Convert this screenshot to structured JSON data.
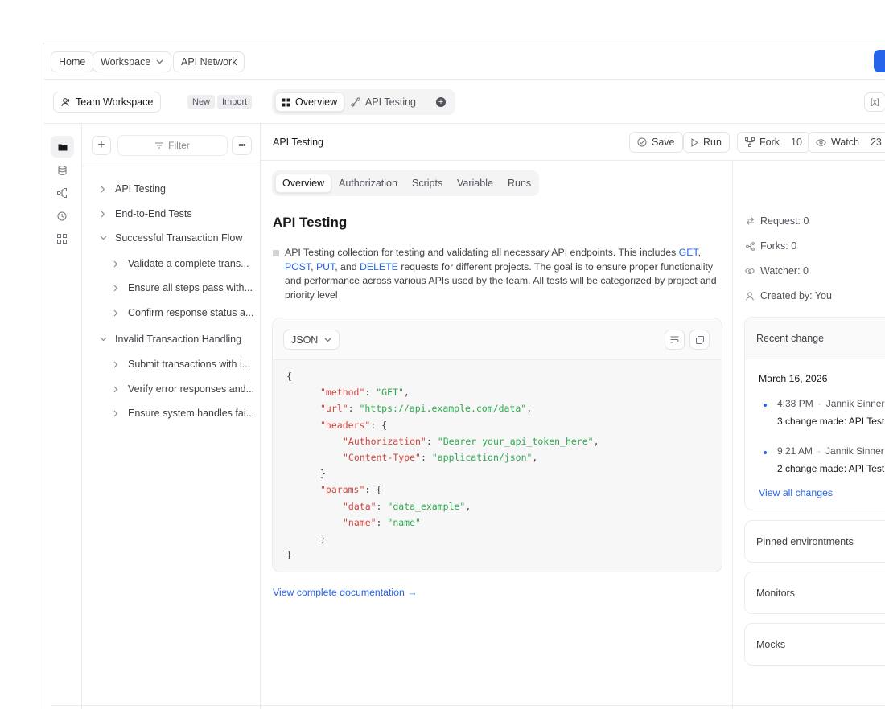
{
  "topnav": {
    "home": "Home",
    "workspace": "Workspace",
    "api_network": "API Network"
  },
  "workspace_bar": {
    "team_workspace": "Team Workspace",
    "new": "New",
    "import": "Import"
  },
  "main_tabs": [
    {
      "label": "Overview",
      "active": true
    },
    {
      "label": "API Testing",
      "active": false
    }
  ],
  "env_chip": "[x]",
  "sidebar": {
    "filter_placeholder": "Filter",
    "items": [
      {
        "label": "API Testing",
        "level": 0,
        "expanded": false
      },
      {
        "label": "End-to-End Tests",
        "level": 0,
        "expanded": false
      },
      {
        "label": "Successful Transaction Flow",
        "level": 0,
        "expanded": true
      },
      {
        "label": "Validate a complete trans...",
        "level": 1,
        "expanded": false
      },
      {
        "label": "Ensure all steps pass with...",
        "level": 1,
        "expanded": false
      },
      {
        "label": "Confirm response status a...",
        "level": 1,
        "expanded": false
      },
      {
        "label": "Invalid Transaction Handling",
        "level": 0,
        "expanded": true
      },
      {
        "label": "Submit transactions with i...",
        "level": 1,
        "expanded": false
      },
      {
        "label": "Verify error responses and...",
        "level": 1,
        "expanded": false
      },
      {
        "label": "Ensure system handles fai...",
        "level": 1,
        "expanded": false
      }
    ]
  },
  "header": {
    "title": "API Testing",
    "save": "Save",
    "run": "Run",
    "fork": "Fork",
    "fork_count": "10",
    "watch": "Watch",
    "watch_count": "23"
  },
  "subtabs": [
    {
      "label": "Overview",
      "active": true
    },
    {
      "label": "Authorization",
      "active": false
    },
    {
      "label": "Scripts",
      "active": false
    },
    {
      "label": "Variable",
      "active": false
    },
    {
      "label": "Runs",
      "active": false
    }
  ],
  "overview": {
    "heading": "API Testing",
    "desc_a": "API Testing collection for testing and validating all necessary API endpoints. This includes ",
    "get": "GET",
    "comma1": ",",
    "post": "POST",
    "comma2": ", ",
    "put": "PUT",
    "and": ", and ",
    "delete": "DELETE",
    "desc_b": " requests for different projects. The goal is to ensure proper functionality",
    "line3": "and performance across various APIs used by the team. All tests will be categorized by project and",
    "line4": "priority level"
  },
  "code": {
    "format": "JSON",
    "lines": [
      {
        "indent": 0,
        "parts": [
          {
            "t": "p",
            "v": "{"
          }
        ]
      },
      {
        "indent": 1,
        "parts": [
          {
            "t": "k",
            "v": "\"method\""
          },
          {
            "t": "p",
            "v": ": "
          },
          {
            "t": "s",
            "v": "\"GET\""
          },
          {
            "t": "p",
            "v": ","
          }
        ]
      },
      {
        "indent": 1,
        "parts": [
          {
            "t": "k",
            "v": "\"url\""
          },
          {
            "t": "p",
            "v": ": "
          },
          {
            "t": "s",
            "v": "\"https://api.example.com/data\""
          },
          {
            "t": "p",
            "v": ","
          }
        ]
      },
      {
        "indent": 1,
        "parts": [
          {
            "t": "k",
            "v": "\"headers\""
          },
          {
            "t": "p",
            "v": ": {"
          }
        ]
      },
      {
        "indent": 2,
        "parts": [
          {
            "t": "k",
            "v": "\"Authorization\""
          },
          {
            "t": "p",
            "v": ": "
          },
          {
            "t": "s",
            "v": "\"Bearer your_api_token_here\""
          },
          {
            "t": "p",
            "v": ","
          }
        ]
      },
      {
        "indent": 2,
        "parts": [
          {
            "t": "k",
            "v": "\"Content-Type\""
          },
          {
            "t": "p",
            "v": ": "
          },
          {
            "t": "s",
            "v": "\"application/json\""
          },
          {
            "t": "p",
            "v": ","
          }
        ]
      },
      {
        "indent": 1,
        "parts": [
          {
            "t": "p",
            "v": "}"
          }
        ]
      },
      {
        "indent": 1,
        "parts": [
          {
            "t": "k",
            "v": "\"params\""
          },
          {
            "t": "p",
            "v": ": {"
          }
        ]
      },
      {
        "indent": 2,
        "parts": [
          {
            "t": "k",
            "v": "\"data\""
          },
          {
            "t": "p",
            "v": ": "
          },
          {
            "t": "s",
            "v": "\"data_example\""
          },
          {
            "t": "p",
            "v": ","
          }
        ]
      },
      {
        "indent": 2,
        "parts": [
          {
            "t": "k",
            "v": "\"name\""
          },
          {
            "t": "p",
            "v": ": "
          },
          {
            "t": "s",
            "v": "\"name\""
          }
        ]
      },
      {
        "indent": 1,
        "parts": [
          {
            "t": "p",
            "v": "}"
          }
        ]
      },
      {
        "indent": 0,
        "parts": [
          {
            "t": "p",
            "v": "}"
          }
        ]
      }
    ]
  },
  "doc_link": "View complete documentation →",
  "info": {
    "request": "Request: 0",
    "forks": "Forks: 0",
    "watcher": "Watcher: 0",
    "created_by": "Created by: You"
  },
  "recent": {
    "title": "Recent change",
    "date": "March 16, 2026",
    "entries": [
      {
        "time": "4:38 PM",
        "user": "Jannik Sinner",
        "desc": "3 change made: API Test"
      },
      {
        "time": "9.21 AM",
        "user": "Jannik Sinner",
        "desc": "2 change made: API Test"
      }
    ],
    "view_all": "View all changes"
  },
  "panels": {
    "pinned": "Pinned environtments",
    "monitors": "Monitors",
    "mocks": "Mocks"
  },
  "colors": {
    "accent": "#2563eb",
    "json_key": "#d1453b",
    "json_string": "#2fa84f"
  }
}
